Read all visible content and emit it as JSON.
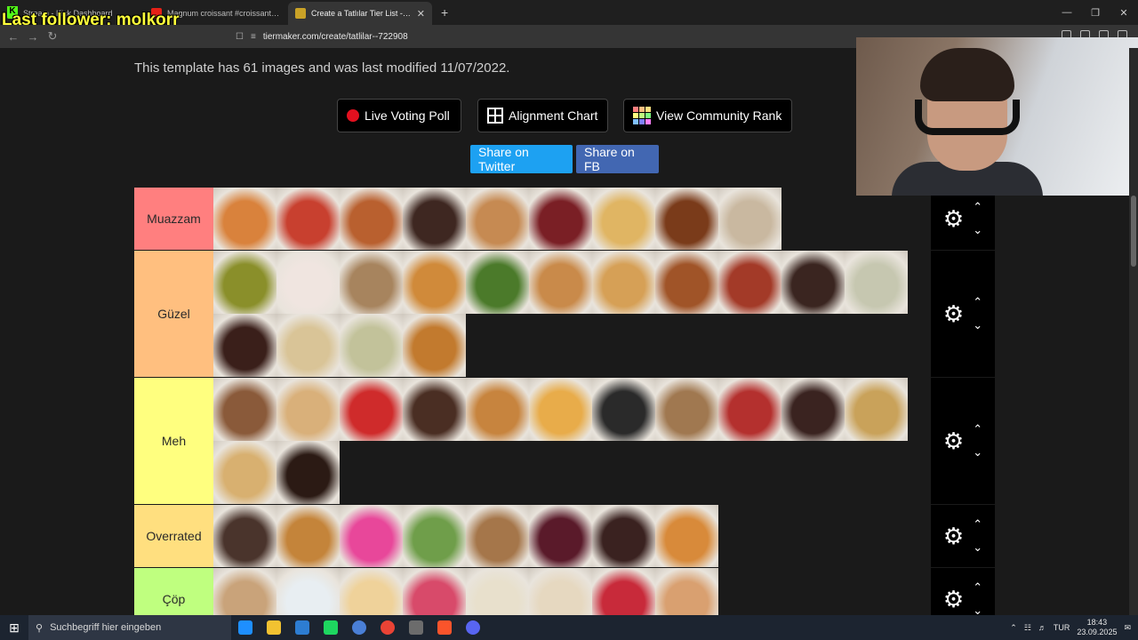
{
  "overlay": {
    "last_follower": "Last follower: molkorr"
  },
  "browser": {
    "tabs": [
      {
        "title": "Stream - Kick Dashboard",
        "color": "#53fc18"
      },
      {
        "title": "Magnum croissant #croissant #taste",
        "color": "#e62117"
      },
      {
        "title": "Create a Tatlılar Tier List - TierMa",
        "color": "#c9a227"
      }
    ],
    "url": "tiermaker.com/create/tatlilar--722908",
    "min": "—",
    "max": "❐",
    "close": "✕",
    "new_tab": "+"
  },
  "page": {
    "info": "This template has 61 images and was last modified 11/07/2022.",
    "buttons": {
      "live_poll": "Live Voting Poll",
      "alignment": "Alignment Chart",
      "community": "View Community Rank",
      "twitter": "Share on Twitter",
      "facebook": "Share on FB"
    },
    "colors": {
      "twitter": "#1da1f2",
      "facebook": "#4267b2"
    },
    "tiers": [
      {
        "label": "Muazzam",
        "color": "#ff7f7f",
        "items": [
          "#d9823c",
          "#c8402f",
          "#b9602f",
          "#3e2721",
          "#c68a52",
          "#7a1f25",
          "#e0b563",
          "#7a3b1a",
          "#c9b8a0"
        ]
      },
      {
        "label": "Güzel",
        "color": "#ffbf7f",
        "items": [
          "#8a8f2a",
          "#f0e5e0",
          "#a7845e",
          "#d08a3a",
          "#4b7a2a",
          "#c98a4a",
          "#d6a056",
          "#a05428",
          "#a33a28",
          "#3a2520",
          "#c6c7b0",
          "#3a1f1a",
          "#d9c497",
          "#c2c29a",
          "#c27a2e"
        ]
      },
      {
        "label": "Meh",
        "color": "#ffff7f",
        "items": [
          "#8a5a3a",
          "#d9b07a",
          "#cf2b2b",
          "#4a2e23",
          "#c7843e",
          "#e8ac4a",
          "#2a2a2a",
          "#a07850",
          "#b4302e",
          "#3a2320",
          "#c9a25a",
          "#d8b070",
          "#2b1a14"
        ]
      },
      {
        "label": "Overrated",
        "color": "#ffdf7f",
        "items": [
          "#4a342c",
          "#c4843a",
          "#e8479a",
          "#6f9e4a",
          "#a5764a",
          "#5a1a2a",
          "#3a2220",
          "#d88a3a"
        ]
      },
      {
        "label": "Çöp",
        "color": "#bfff7f",
        "items": [
          "#c9a37a",
          "#e8eef2",
          "#efd29a",
          "#d84a6a",
          "#e8e0cc",
          "#e6d8c0",
          "#c82a3a",
          "#d9a070"
        ]
      }
    ],
    "tier_controls": {
      "gear": "⚙",
      "up": "⌃",
      "down": "⌄"
    }
  },
  "taskbar": {
    "search_placeholder": "Suchbegriff hier eingeben",
    "lang": "TUR",
    "time": "18:43",
    "date": "23.09.2025",
    "icons": [
      "#1e8fff",
      "#f2c231",
      "#2d7dd2",
      "#1ed760",
      "#4a7fd6",
      "#ea4335",
      "#6c6c6c",
      "#fb542b",
      "#5865f2"
    ]
  }
}
